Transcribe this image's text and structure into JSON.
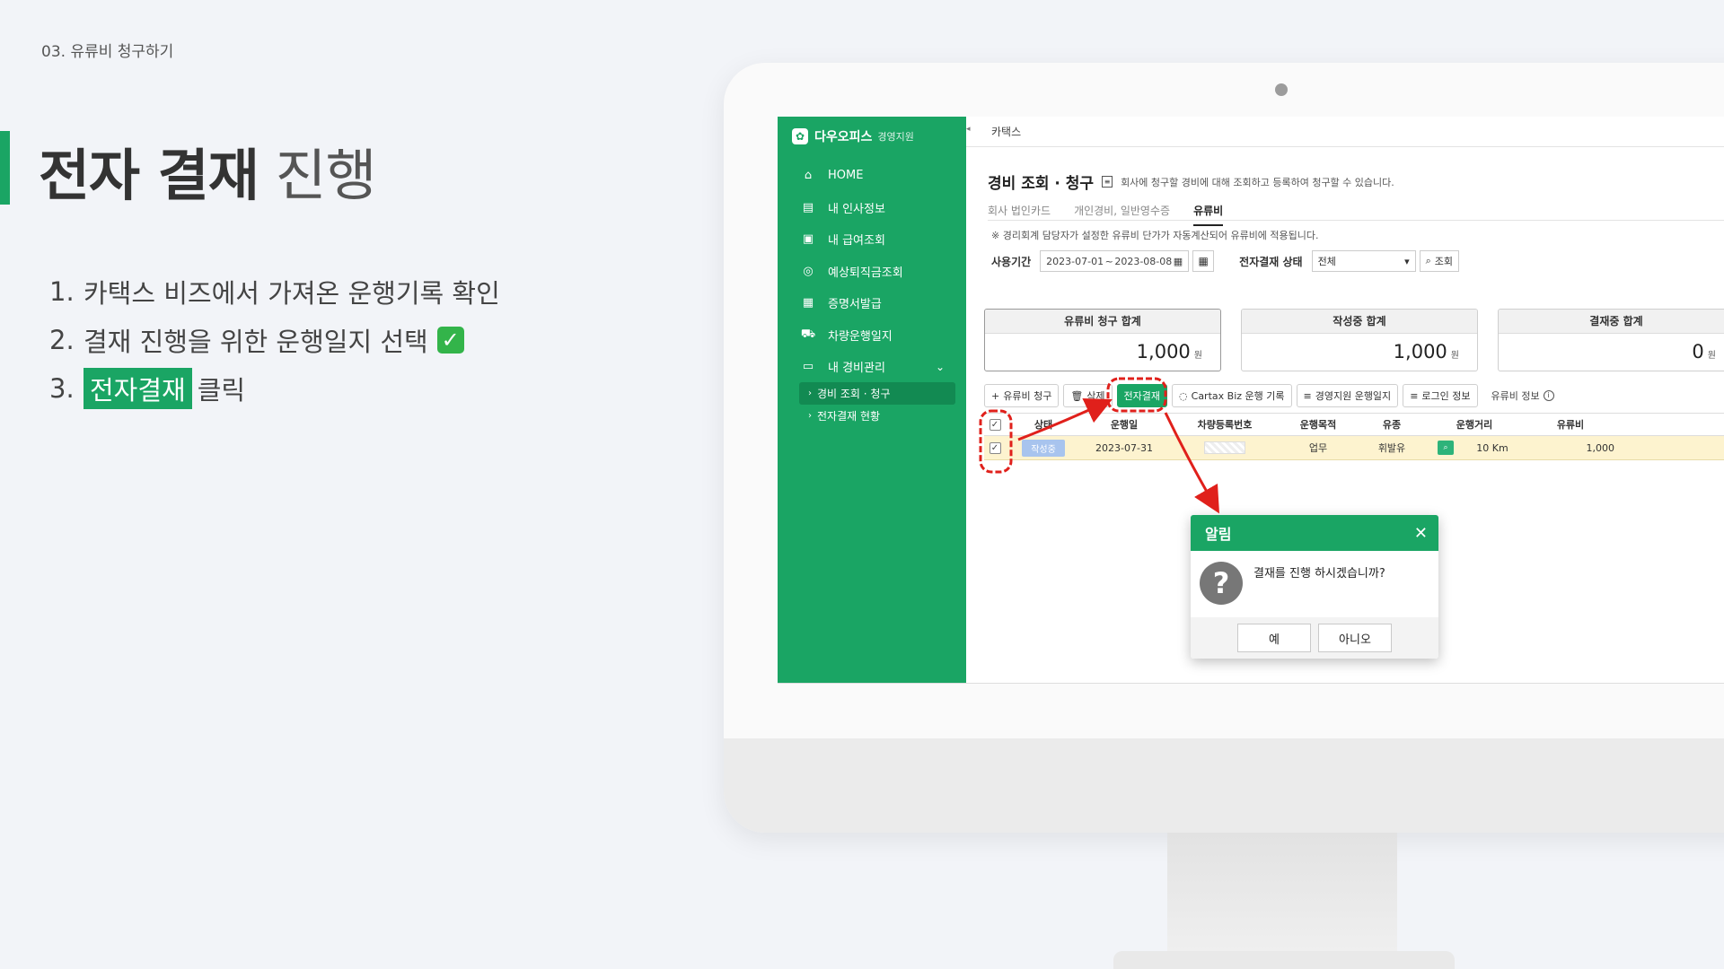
{
  "slide": {
    "breadcrumb": "03. 유류비 청구하기",
    "title_bold": "전자 결재",
    "title_light": "진행",
    "steps": [
      {
        "num": "1.",
        "text": "카택스 비즈에서 가져온 운행기록 확인"
      },
      {
        "num": "2.",
        "text": "결재 진행을 위한 운행일지 선택"
      },
      {
        "num": "3.",
        "highlight": "전자결재",
        "text": "클릭"
      }
    ]
  },
  "app": {
    "brand": "다우오피스",
    "brand_sub": "경영지원",
    "breadcrumb": "카택스",
    "menu": [
      {
        "label": "HOME",
        "icon": "home-icon"
      },
      {
        "label": "내 인사정보",
        "icon": "id-card-icon"
      },
      {
        "label": "내 급여조회",
        "icon": "wallet-icon"
      },
      {
        "label": "예상퇴직금조회",
        "icon": "search-money-icon"
      },
      {
        "label": "증명서발급",
        "icon": "certificate-icon"
      },
      {
        "label": "차량운행일지",
        "icon": "car-icon"
      },
      {
        "label": "내 경비관리",
        "icon": "card-icon"
      }
    ],
    "submenu": [
      {
        "label": "경비 조회 · 청구"
      },
      {
        "label": "전자결재 현황"
      }
    ],
    "page_title": "경비 조회 · 청구",
    "page_desc": "회사에 청구할 경비에 대해 조회하고 등록하여 청구할 수 있습니다.",
    "tabs": [
      "회사 법인카드",
      "개인경비, 일반영수증",
      "유류비"
    ],
    "notice": "※ 경리회계 담당자가 설정한 유류비 단가가 자동계산되어 유류비에 적용됩니다.",
    "filter": {
      "period_label": "사용기간",
      "date_from": "2023-07-01",
      "date_sep": "~",
      "date_to": "2023-08-08",
      "status_label": "전자결재 상태",
      "status_value": "전체",
      "search_label": "조회"
    },
    "cards": [
      {
        "title": "유류비 청구 합계",
        "value": "1,000",
        "unit": "원"
      },
      {
        "title": "작성중 합계",
        "value": "1,000",
        "unit": "원"
      },
      {
        "title": "결재중 합계",
        "value": "0",
        "unit": "원"
      }
    ],
    "toolbar": {
      "claim": "유류비 청구",
      "delete": "삭제",
      "approve": "전자결재",
      "cartax": "Cartax Biz 운행 기록",
      "log": "경영지원 운행일지",
      "login": "로그인 정보",
      "info": "유류비 정보"
    },
    "columns": [
      "상태",
      "운행일",
      "차량등록번호",
      "운행목적",
      "유종",
      "운행거리",
      "유류비"
    ],
    "rows": [
      {
        "status": "작성중",
        "date": "2023-07-31",
        "purpose": "업무",
        "fuel": "휘발유",
        "distance": "10 Km",
        "cost": "1,000"
      }
    ],
    "dialog": {
      "title": "알림",
      "message": "결재를 진행 하시겠습니까?",
      "yes": "예",
      "no": "아니오"
    }
  },
  "colors": {
    "accent": "#1aa564",
    "annotation": "#e0201b",
    "row_highlight": "#fdf3cf"
  }
}
